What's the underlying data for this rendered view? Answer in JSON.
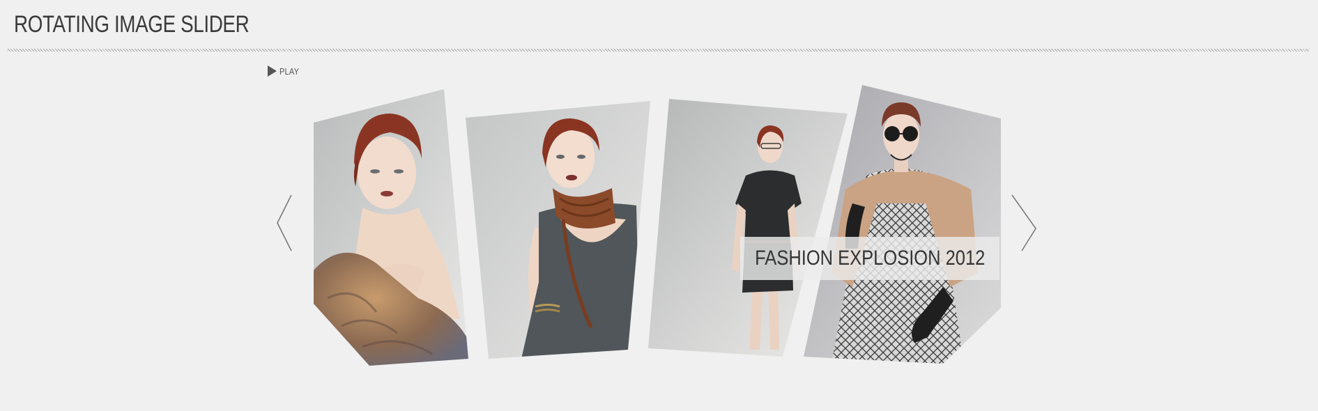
{
  "header": {
    "title": "ROTATING IMAGE SLIDER"
  },
  "controls": {
    "play_label": "PLAY",
    "play_icon": "play-icon",
    "prev_icon": "chevron-left-icon",
    "next_icon": "chevron-right-icon"
  },
  "slider": {
    "slides": [
      {
        "subject": "red-haired model holding fur wrap"
      },
      {
        "subject": "red-haired model in grey top with knitted scarf"
      },
      {
        "subject": "model in black dress standing"
      },
      {
        "subject": "model in tan cape with sunglasses and helmet"
      }
    ],
    "caption": "FASHION EXPLOSION 2012"
  },
  "colors": {
    "background": "#f0f0f0",
    "text": "#333333",
    "caption_bg": "#ececec"
  }
}
